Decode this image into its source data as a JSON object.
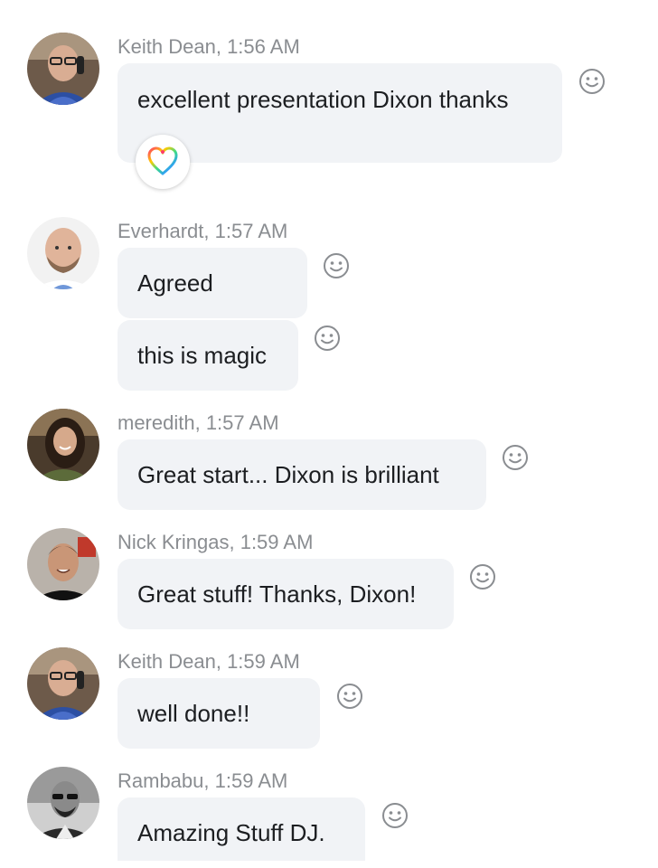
{
  "messages": [
    {
      "sender": "Keith Dean, 1:56 AM",
      "bubbles": [
        "excellent presentation Dixon thanks"
      ],
      "reaction": {
        "icon": "rainbow-heart-icon"
      }
    },
    {
      "sender": "Everhardt, 1:57 AM",
      "bubbles": [
        "Agreed",
        "this is magic"
      ]
    },
    {
      "sender": "meredith, 1:57 AM",
      "bubbles": [
        "Great start... Dixon is brilliant"
      ]
    },
    {
      "sender": "Nick Kringas, 1:59 AM",
      "bubbles": [
        "Great stuff! Thanks, Dixon!"
      ]
    },
    {
      "sender": "Keith Dean, 1:59 AM",
      "bubbles": [
        "well done!!"
      ]
    },
    {
      "sender": "Rambabu, 1:59 AM",
      "bubbles": [
        "Amazing Stuff DJ."
      ]
    }
  ],
  "icons": {
    "add_reaction": "smiley-face-icon"
  },
  "colors": {
    "bubble_bg": "#f1f3f6",
    "sender_text": "#8a8d91",
    "message_text": "#1c1e21",
    "icon_gray": "#8a8d91"
  }
}
